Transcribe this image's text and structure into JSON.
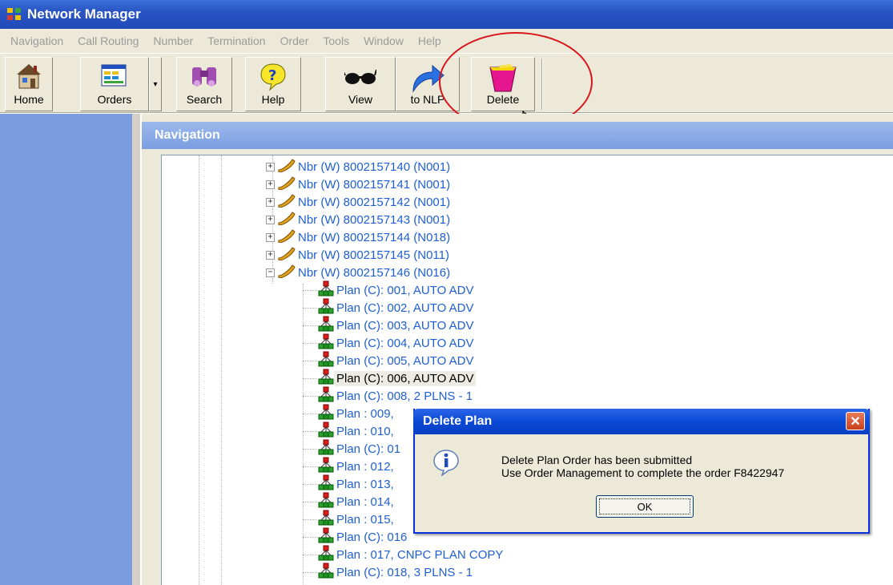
{
  "window": {
    "title": "Network Manager"
  },
  "menu": [
    "Navigation",
    "Call Routing",
    "Number",
    "Termination",
    "Order",
    "Tools",
    "Window",
    "Help"
  ],
  "toolbar": {
    "home": "Home",
    "orders": "Orders",
    "search": "Search",
    "help": "Help",
    "view": "View",
    "to_nlp": "to NLP",
    "delete": "Delete"
  },
  "navigation": {
    "title": "Navigation",
    "numbers": [
      "Nbr (W) 8002157140 (N001)",
      "Nbr (W) 8002157141 (N001)",
      "Nbr (W) 8002157142 (N001)",
      "Nbr (W) 8002157143 (N001)",
      "Nbr (W) 8002157144 (N018)",
      "Nbr (W) 8002157145 (N011)",
      "Nbr (W) 8002157146 (N016)"
    ],
    "plans": [
      "Plan (C): 001, AUTO ADV",
      "Plan (C): 002, AUTO ADV",
      "Plan (C): 003, AUTO ADV",
      "Plan (C): 004, AUTO ADV",
      "Plan (C): 005, AUTO ADV",
      "Plan (C): 006, AUTO ADV",
      "Plan (C): 008, 2 PLNS - 1",
      "Plan : 009,",
      "Plan : 010,",
      "Plan (C): 01",
      "Plan : 012,",
      "Plan : 013,",
      "Plan : 014,",
      "Plan : 015,",
      "Plan (C): 016",
      "Plan : 017, CNPC PLAN COPY",
      "Plan (C): 018, 3 PLNS - 1"
    ]
  },
  "dialog": {
    "title": "Delete Plan",
    "line1": "Delete Plan Order has been submitted",
    "line2": "Use Order Management to complete the order F8422947",
    "ok": "OK",
    "close": "✕"
  }
}
